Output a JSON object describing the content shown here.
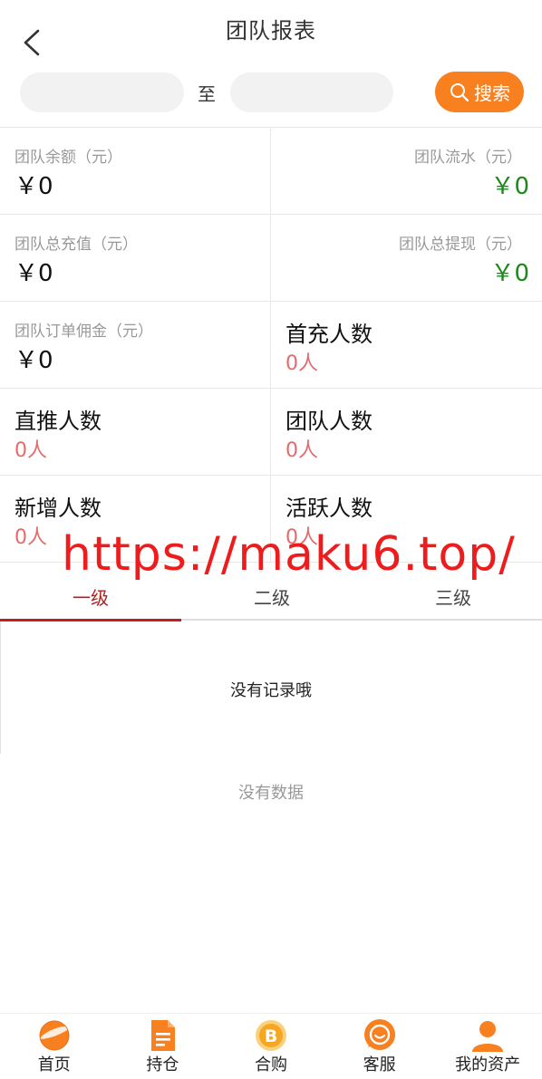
{
  "header": {
    "title": "团队报表"
  },
  "search": {
    "separator": "至",
    "button_label": "搜索",
    "start_value": "",
    "end_value": ""
  },
  "stats": {
    "team_balance": {
      "label": "团队余额（元）",
      "value": "￥0"
    },
    "team_flow": {
      "label": "团队流水（元）",
      "value": "￥0"
    },
    "team_total_recharge": {
      "label": "团队总充值（元）",
      "value": "￥0"
    },
    "team_total_withdraw": {
      "label": "团队总提现（元）",
      "value": "￥0"
    },
    "team_order_commission": {
      "label": "团队订单佣金（元）",
      "value": "￥0"
    },
    "first_recharge_count": {
      "label": "首充人数",
      "value": "0人"
    },
    "direct_count": {
      "label": "直推人数",
      "value": "0人"
    },
    "team_count": {
      "label": "团队人数",
      "value": "0人"
    },
    "new_count": {
      "label": "新增人数",
      "value": "0人"
    },
    "active_count": {
      "label": "活跃人数",
      "value": "0人"
    }
  },
  "watermark": "https://maku6.top/",
  "tabs": [
    {
      "label": "一级",
      "active": true
    },
    {
      "label": "二级",
      "active": false
    },
    {
      "label": "三级",
      "active": false
    }
  ],
  "records": {
    "empty_text": "没有记录哦"
  },
  "data_empty_text": "没有数据",
  "bottom_nav": [
    {
      "label": "首页",
      "icon": "home-planet-icon"
    },
    {
      "label": "持仓",
      "icon": "document-icon"
    },
    {
      "label": "合购",
      "icon": "bitcoin-icon"
    },
    {
      "label": "客服",
      "icon": "chat-icon"
    },
    {
      "label": "我的资产",
      "icon": "user-icon"
    }
  ],
  "colors": {
    "accent": "#f8801f",
    "positive": "#1a8a1a",
    "count": "#e56b6b",
    "tab_active": "#b02020",
    "watermark": "#ee1c1c"
  }
}
